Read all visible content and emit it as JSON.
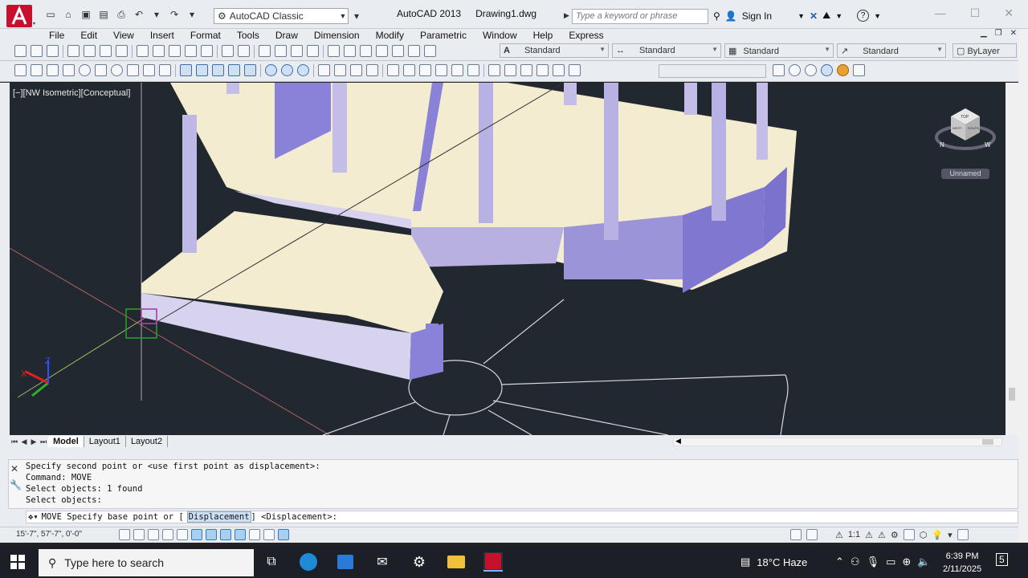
{
  "window": {
    "app_title": "AutoCAD 2013",
    "file_name": "Drawing1.dwg"
  },
  "workspace": {
    "label": "AutoCAD Classic"
  },
  "search": {
    "placeholder": "Type a keyword or phrase"
  },
  "account": {
    "sign_in": "Sign In"
  },
  "menus": [
    "File",
    "Edit",
    "View",
    "Insert",
    "Format",
    "Tools",
    "Draw",
    "Dimension",
    "Modify",
    "Parametric",
    "Window",
    "Help",
    "Express"
  ],
  "styles": {
    "text_style": "Standard",
    "dim_style": "Standard",
    "table_style": "Standard",
    "mleader_style": "Standard",
    "layer": "ByLayer"
  },
  "viewport": {
    "label": "[−][NW Isometric][Conceptual]",
    "viewcube_name": "Unnamed",
    "ucs_z": "Z",
    "ucs_x": "X"
  },
  "viewcube": {
    "face_top": "TOP",
    "face_left": "WEST",
    "face_front": "SOUTH",
    "compass_n": "N",
    "compass_w": "W"
  },
  "tabs": {
    "model": "Model",
    "layout1": "Layout1",
    "layout2": "Layout2"
  },
  "command": {
    "history": [
      "Specify second point or <use first point as displacement>:",
      "Command:  MOVE",
      "Select objects: 1 found",
      "Select objects:"
    ],
    "prompt_cmd": "MOVE Specify base point or [",
    "prompt_option": "Displacement",
    "prompt_tail": "] <Displacement>:"
  },
  "status": {
    "coords": "15'-7\",  57'-7\",  0'-0\"",
    "annotation_scale": "1:1"
  },
  "taskbar": {
    "search_placeholder": "Type here to search",
    "weather": "18°C  Haze",
    "time": "6:39 PM",
    "date": "2/11/2025",
    "notifications": "5"
  },
  "colors": {
    "stair_top": "#f4ecd0",
    "stair_side": "#8a82d8",
    "background": "#212830"
  }
}
